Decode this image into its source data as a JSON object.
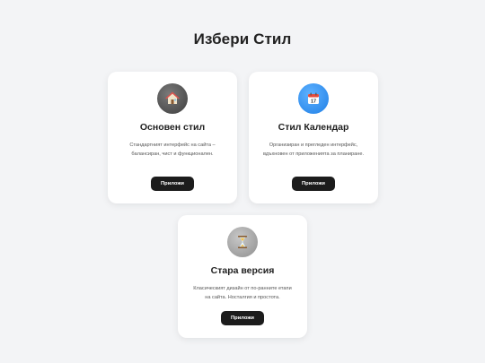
{
  "page": {
    "title": "Избери Стил"
  },
  "cards": [
    {
      "icon": "house-icon",
      "title": "Основен стил",
      "description": "Стандартният интерфейс на сайта – балансиран, чист и функционален.",
      "button_label": "Приложи"
    },
    {
      "icon": "calendar-icon",
      "title": "Стил Календар",
      "description": "Организиран и прегледен интерфейс, вдъхновен от приложенията за планиране.",
      "button_label": "Приложи"
    },
    {
      "icon": "hourglass-icon",
      "title": "Стара версия",
      "description": "Класическият дизайн от по-ранните етапи на сайта. Носталгия и простота.",
      "button_label": "Приложи"
    }
  ],
  "colors": {
    "background": "#f3f4f6",
    "button": "#1c1c1c",
    "accent_blue": "#1f7fe6"
  }
}
